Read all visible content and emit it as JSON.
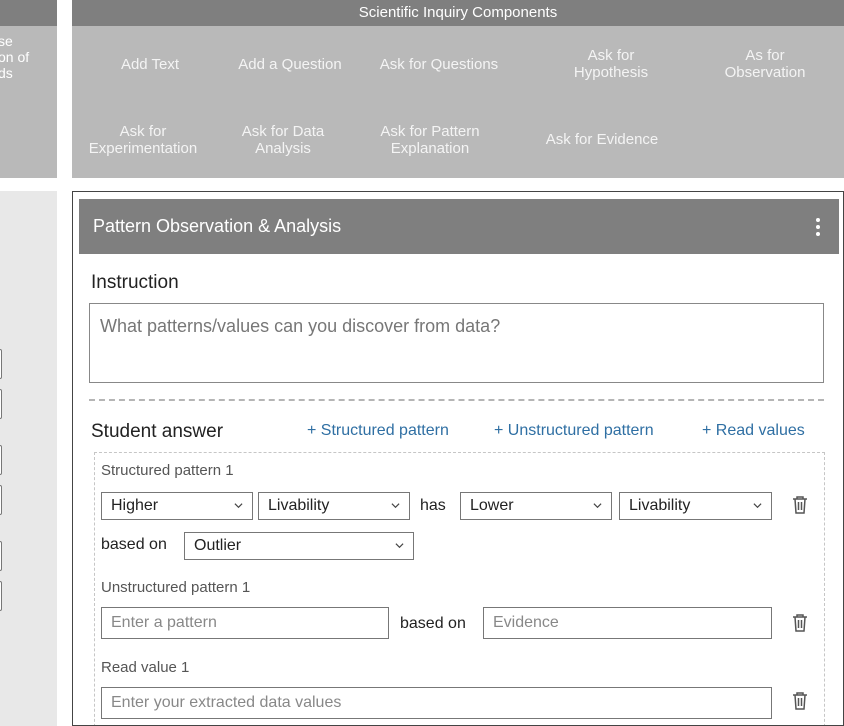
{
  "left_top": {
    "text": "se\non of\nds"
  },
  "components": {
    "header": "Scientific Inquiry Components",
    "buttons": [
      "Add Text",
      "Add a Question",
      "Ask for Questions",
      "Ask for\nHypothesis",
      "As for\nObservation",
      "Ask for\nExperimentation",
      "Ask for Data\nAnalysis",
      "Ask for Pattern\nExplanation",
      "Ask for Evidence"
    ]
  },
  "card": {
    "title": "Pattern Observation & Analysis",
    "menu_icon": "kebab-menu-icon",
    "instruction_label": "Instruction",
    "instruction_text": "What patterns/values can you discover from data?",
    "student_answer_label": "Student answer",
    "links": {
      "structured": "+ Structured pattern",
      "unstructured": "+ Unstructured pattern",
      "read_values": "+ Read values"
    },
    "structured_pattern": {
      "label": "Structured pattern 1",
      "subject_level": "Higher",
      "subject_field": "Livability",
      "has": "has",
      "object_level": "Lower",
      "object_field": "Livability",
      "based_on": "based on",
      "basis": "Outlier"
    },
    "unstructured_pattern": {
      "label": "Unstructured pattern 1",
      "pattern_placeholder": "Enter a pattern",
      "based_on": "based on",
      "evidence_placeholder": "Evidence"
    },
    "read_value": {
      "label": "Read value 1",
      "placeholder": "Enter your extracted data values"
    }
  },
  "colors": {
    "header_gray": "#7f7f7f",
    "bar_gray": "#b9b9b9",
    "link_blue": "#2f6fa3"
  }
}
